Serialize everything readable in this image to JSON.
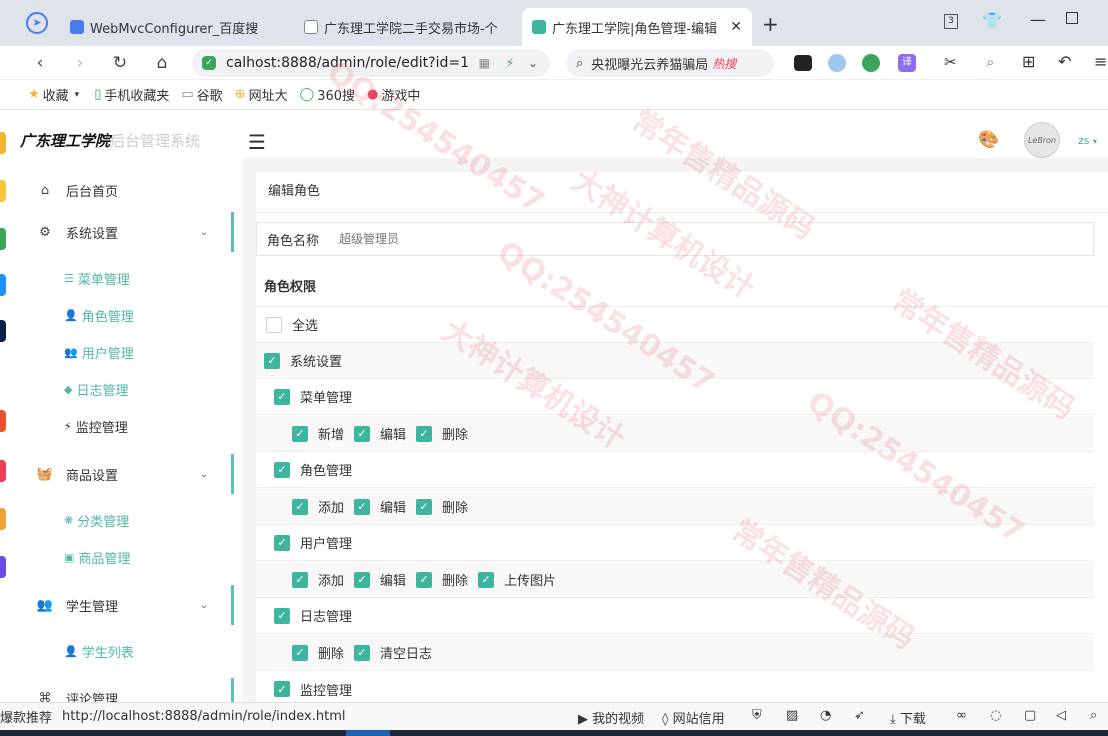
{
  "browser": {
    "tabs": [
      {
        "label": "WebMvcConfigurer_百度搜",
        "color": "#4a7cf0"
      },
      {
        "label": "广东理工学院二手交易市场-个",
        "color": "#888888"
      },
      {
        "label": "广东理工学院|角色管理-编辑",
        "color": "#3fb5a0"
      }
    ],
    "new_tab": "+",
    "badge": "3",
    "url": "calhost:8888/admin/role/edit?id=1",
    "search_text": "央视曝光云养猫骗局",
    "search_hot": "热搜",
    "bookmarks": [
      "收藏",
      "手机收藏夹",
      "谷歌",
      "网址大",
      "360搜",
      "游戏中"
    ],
    "status_left": "爆款推荐",
    "status_url": "http://localhost:8888/admin/role/index.html",
    "status_video": "我的视频",
    "status_trust": "网站信用",
    "status_download": "下载"
  },
  "sidebar": {
    "logo_bold": "广东理工学院",
    "logo_light": "后台管理系统",
    "home": "后台首页",
    "system": "系统设置",
    "system_items": [
      {
        "label": "菜单管理",
        "icon": "☰"
      },
      {
        "label": "角色管理",
        "icon": "👤"
      },
      {
        "label": "用户管理",
        "icon": "👥"
      },
      {
        "label": "日志管理",
        "icon": "◆"
      },
      {
        "label": "监控管理",
        "icon": "⚡"
      }
    ],
    "goods": "商品设置",
    "goods_items": [
      {
        "label": "分类管理",
        "icon": "❋"
      },
      {
        "label": "商品管理",
        "icon": "▣"
      }
    ],
    "student": "学生管理",
    "student_items": [
      {
        "label": "学生列表",
        "icon": "👤"
      }
    ],
    "comment": "评论管理"
  },
  "header": {
    "username": "zs",
    "avatar_text": "LeBron"
  },
  "form": {
    "title": "编辑角色",
    "role_name_label": "角色名称",
    "role_name_value": "超级管理员",
    "permission_title": "角色权限",
    "select_all": "全选",
    "system": "系统设置",
    "menu": "菜单管理",
    "menu_perms": [
      "新增",
      "编辑",
      "删除"
    ],
    "role": "角色管理",
    "role_perms": [
      "添加",
      "编辑",
      "删除"
    ],
    "user": "用户管理",
    "user_perms": [
      "添加",
      "编辑",
      "删除",
      "上传图片"
    ],
    "log": "日志管理",
    "log_perms": [
      "删除",
      "清空日志"
    ],
    "monitor": "监控管理"
  },
  "watermarks": [
    "大神计算机设计",
    "QQ:254540457",
    "常年售精品源码"
  ]
}
